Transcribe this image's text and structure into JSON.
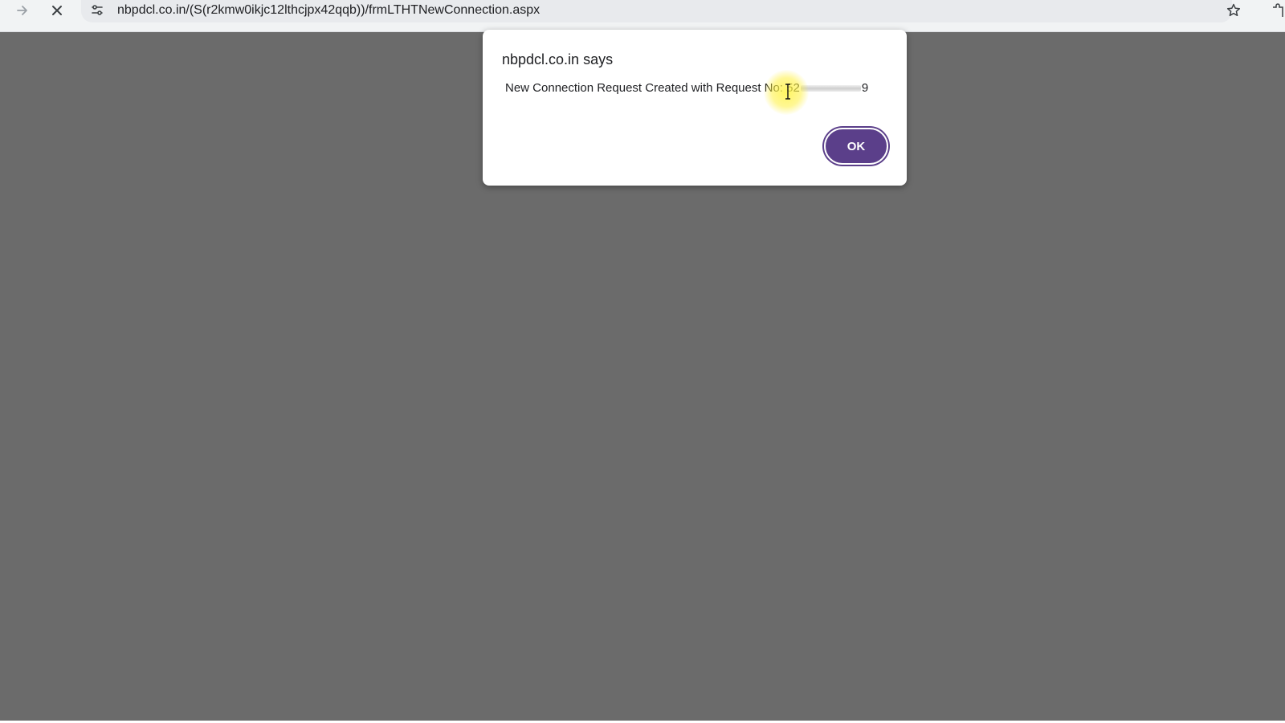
{
  "browser": {
    "url": "nbpdcl.co.in/(S(r2kmw0ikjc12lthcjpx42qqb))/frmLTHTNewConnection.aspx",
    "icons": {
      "back": "arrow-right-icon",
      "stop": "close-icon",
      "site_info": "tune-icon",
      "bookmark": "star-icon",
      "extensions": "puzzle-icon"
    }
  },
  "dialog": {
    "title": "nbpdcl.co.in says",
    "message_prefix": "New Connection Request Created with Request No: 52",
    "message_suffix": "9",
    "ok_label": "OK"
  },
  "colors": {
    "overlay": "#6b6b6b",
    "ok_button": "#5b3f8a",
    "toolbar": "#f1f3f4"
  }
}
